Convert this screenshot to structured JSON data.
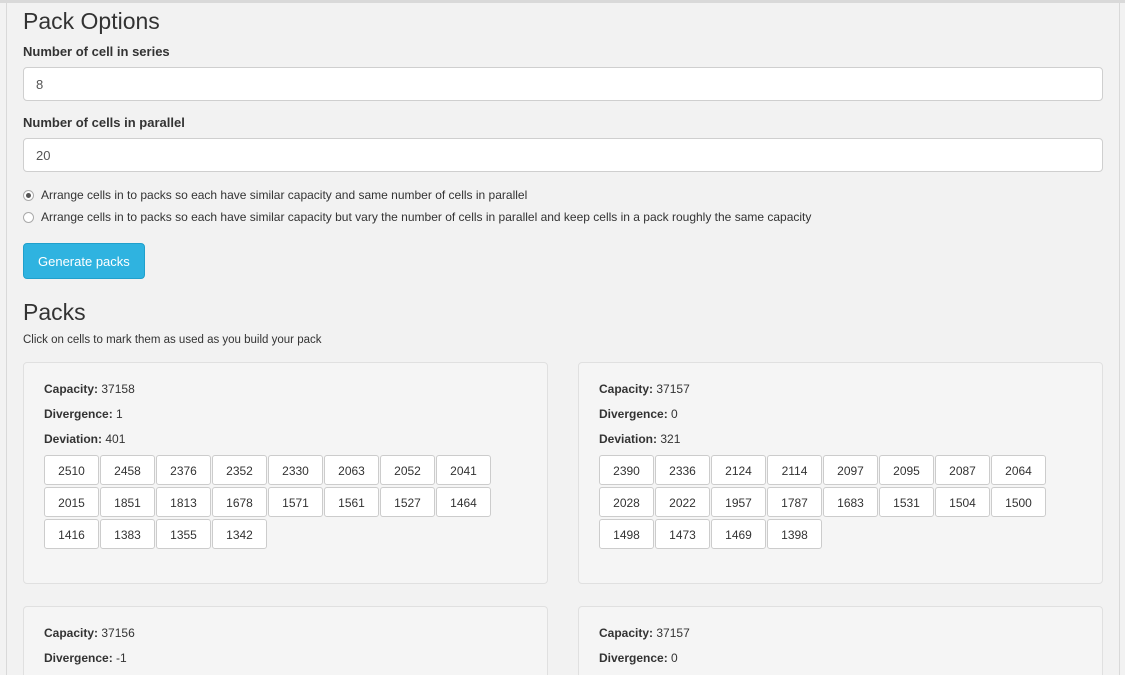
{
  "options": {
    "title": "Pack Options",
    "series_label": "Number of cell in series",
    "series_value": "8",
    "parallel_label": "Number of cells in parallel",
    "parallel_value": "20",
    "radio_1": "Arrange cells in to packs so each have similar capacity and same number of cells in parallel",
    "radio_2": "Arrange cells in to packs so each have similar capacity but vary the number of cells in parallel and keep cells in a pack roughly the same capacity",
    "radio_selected": 1,
    "generate_button": "Generate packs"
  },
  "packs_section": {
    "title": "Packs",
    "hint": "Click on cells to mark them as used as you build your pack"
  },
  "labels": {
    "capacity": "Capacity:",
    "divergence": "Divergence:",
    "deviation": "Deviation:"
  },
  "packs": [
    {
      "capacity": "37158",
      "divergence": "1",
      "deviation": "401",
      "cells": [
        "2510",
        "2458",
        "2376",
        "2352",
        "2330",
        "2063",
        "2052",
        "2041",
        "2015",
        "1851",
        "1813",
        "1678",
        "1571",
        "1561",
        "1527",
        "1464",
        "1416",
        "1383",
        "1355",
        "1342"
      ]
    },
    {
      "capacity": "37157",
      "divergence": "0",
      "deviation": "321",
      "cells": [
        "2390",
        "2336",
        "2124",
        "2114",
        "2097",
        "2095",
        "2087",
        "2064",
        "2028",
        "2022",
        "1957",
        "1787",
        "1683",
        "1531",
        "1504",
        "1500",
        "1498",
        "1473",
        "1469",
        "1398"
      ]
    },
    {
      "capacity": "37156",
      "divergence": "-1"
    },
    {
      "capacity": "37157",
      "divergence": "0"
    }
  ]
}
